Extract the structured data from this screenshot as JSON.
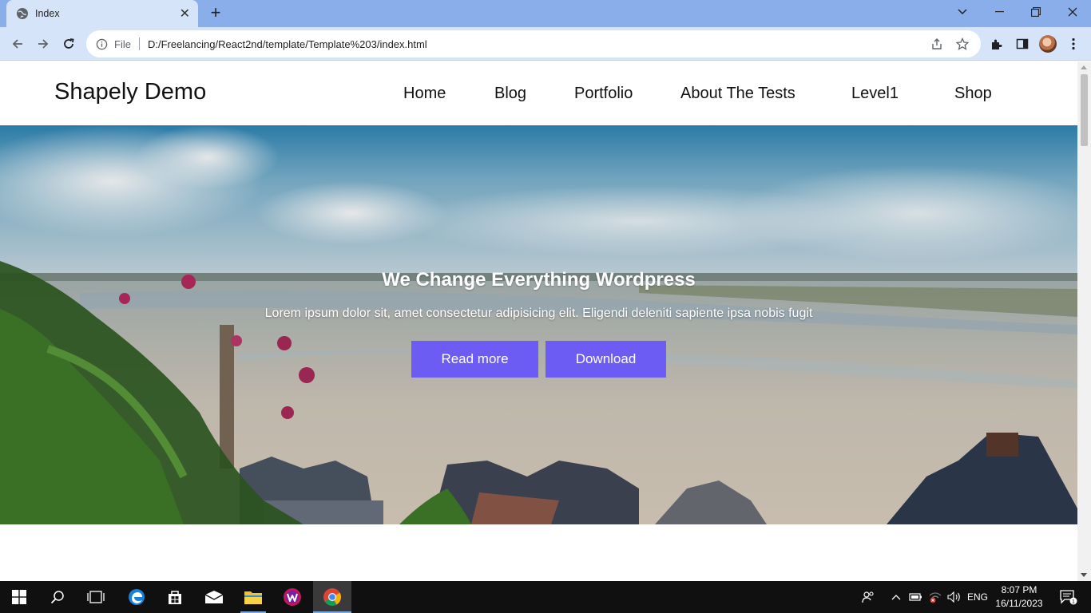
{
  "browser": {
    "tab_title": "Index",
    "tab_close": "✕",
    "new_tab": "+",
    "scheme_label": "File",
    "url": "D:/Freelancing/React2nd/template/Template%203/index.html",
    "accent_color": "#8aaeea"
  },
  "site": {
    "logo": "Shapely Demo",
    "nav": {
      "home": "Home",
      "blog": "Blog",
      "portfolio": "Portfolio",
      "about": "About The Tests",
      "level1": "Level1",
      "shop": "Shop"
    },
    "hero": {
      "title": "We Change Everything Wordpress",
      "subtitle": "Lorem ipsum dolor sit, amet consectetur adipisicing elit. Eligendi deleniti sapiente ipsa nobis fugit",
      "btn_read_more": "Read more",
      "btn_download": "Download",
      "button_color": "#6c5cf4"
    }
  },
  "taskbar": {
    "language": "ENG",
    "time": "8:07 PM",
    "date": "16/11/2023",
    "notification_count": "1"
  }
}
